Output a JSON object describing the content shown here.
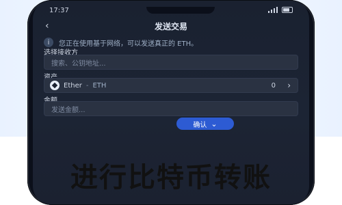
{
  "status_bar": {
    "time": "17:37"
  },
  "header": {
    "title": "发送交易"
  },
  "notice": {
    "text": "您正在使用基于网络，可以发送真正的 ETH。"
  },
  "form": {
    "recipient_label": "选择接收方",
    "recipient_placeholder": "搜索、公钥地址...",
    "asset_label": "资产",
    "asset_name": "Ether",
    "asset_symbol": "ETH",
    "asset_balance": "0",
    "amount_label": "金额",
    "amount_placeholder": "发送金额..."
  },
  "actions": {
    "confirm_label": "确认"
  },
  "caption": {
    "text": "进行比特币转账"
  },
  "colors": {
    "primary": "#2d5bd3",
    "screen_bg": "#1c2434",
    "field_bg": "#2a3242"
  }
}
